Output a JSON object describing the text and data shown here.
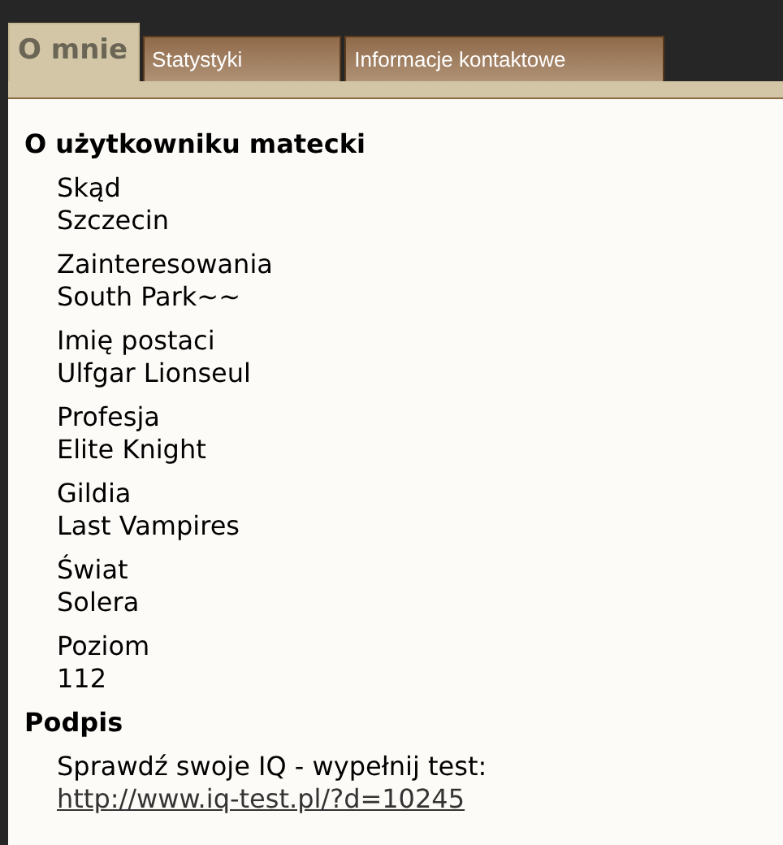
{
  "tabs": [
    {
      "label": "O mnie",
      "selected": true
    },
    {
      "label": "Statystyki",
      "selected": false
    },
    {
      "label": "Informacje kontaktowe",
      "selected": false
    }
  ],
  "about": {
    "title": "O użytkowniku matecki",
    "fields": [
      {
        "label": "Skąd",
        "value": "Szczecin"
      },
      {
        "label": "Zainteresowania",
        "value": "South Park~~"
      },
      {
        "label": "Imię postaci",
        "value": "Ulfgar Lionseul"
      },
      {
        "label": "Profesja",
        "value": "Elite Knight"
      },
      {
        "label": "Gildia",
        "value": "Last Vampires"
      },
      {
        "label": "Świat",
        "value": "Solera"
      },
      {
        "label": "Poziom",
        "value": "112"
      }
    ]
  },
  "signature": {
    "title": "Podpis",
    "text": "Sprawdź swoje IQ - wypełnij test:",
    "link": "http://www.iq-test.pl/?d=10245"
  }
}
